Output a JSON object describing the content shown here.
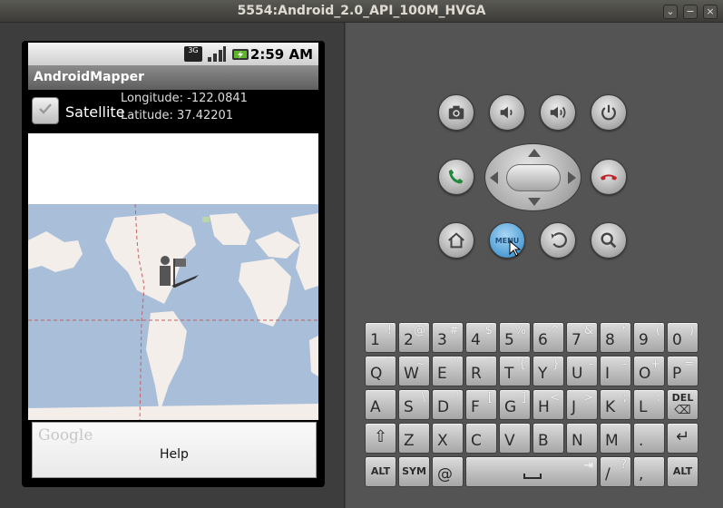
{
  "window": {
    "title": "5554:Android_2.0_API_100M_HVGA"
  },
  "window_buttons": [
    "⌄",
    "−",
    "×"
  ],
  "status": {
    "network": "3G",
    "time": "2:59 AM"
  },
  "app": {
    "title": "AndroidMapper"
  },
  "controls": {
    "satellite_label": "Satellite",
    "satellite_checked": true,
    "longitude": "Longitude: -122.0841",
    "latitude": "Latitude: 37.42201"
  },
  "menu": {
    "help_label": "Help",
    "watermark": "Google"
  },
  "hardware": {
    "menu_label": "MENU"
  },
  "keyboard": {
    "row1": [
      [
        "1",
        "!"
      ],
      [
        "2",
        "@"
      ],
      [
        "3",
        "#"
      ],
      [
        "4",
        "$"
      ],
      [
        "5",
        "%"
      ],
      [
        "6",
        "^"
      ],
      [
        "7",
        "&"
      ],
      [
        "8",
        "*"
      ],
      [
        "9",
        "("
      ],
      [
        "0",
        ")"
      ]
    ],
    "row2": [
      [
        "Q",
        "`"
      ],
      [
        "W",
        "~"
      ],
      [
        "E",
        "\""
      ],
      [
        "R",
        "`"
      ],
      [
        "T",
        "{"
      ],
      [
        "Y",
        "}"
      ],
      [
        "U",
        "-"
      ],
      [
        "I",
        "-"
      ],
      [
        "O",
        "+"
      ],
      [
        "P",
        "="
      ]
    ],
    "row3": [
      [
        "A",
        ""
      ],
      [
        "S",
        "\\"
      ],
      [
        "D",
        "'"
      ],
      [
        "F",
        "["
      ],
      [
        "G",
        "]"
      ],
      [
        "H",
        "<"
      ],
      [
        "J",
        ">"
      ],
      [
        "K",
        ";"
      ],
      [
        "L",
        ":"
      ]
    ],
    "row4": [
      [
        "Z",
        ""
      ],
      [
        "X",
        ""
      ],
      [
        "C",
        ""
      ],
      [
        "V",
        ""
      ],
      [
        "B",
        ""
      ],
      [
        "N",
        ""
      ],
      [
        "M",
        ""
      ],
      [
        ".",
        ""
      ]
    ],
    "del_label": "DEL",
    "alt_label": "ALT",
    "sym_label": "SYM",
    "at_label": "@",
    "slash_label": "/",
    "slash_alt": "?",
    "comma_label": ","
  }
}
